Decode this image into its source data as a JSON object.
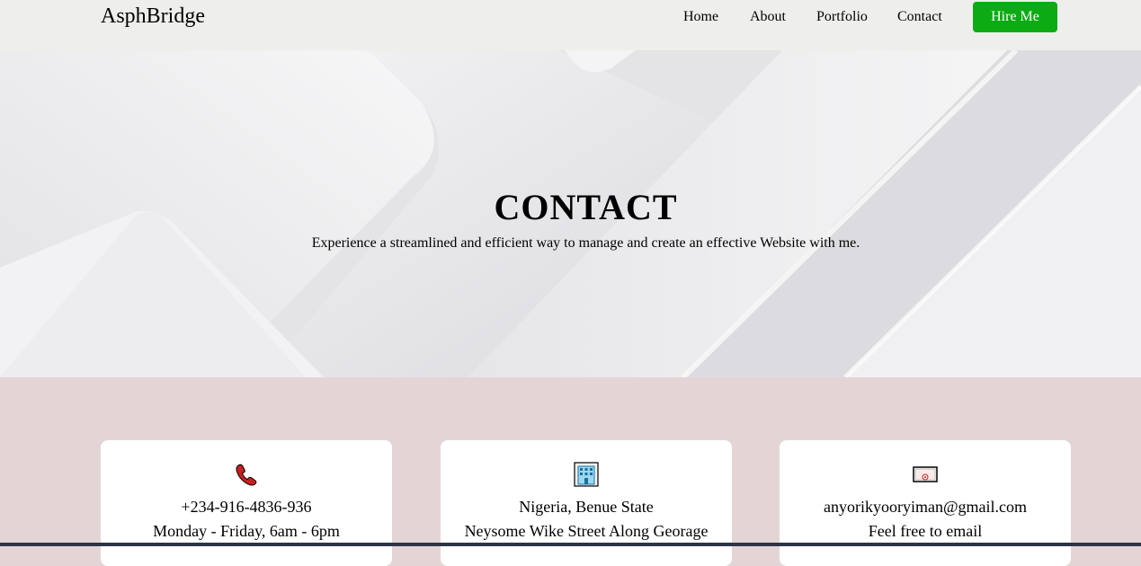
{
  "nav": {
    "brand": "AsphBridge",
    "links": [
      "Home",
      "About",
      "Portfolio",
      "Contact"
    ],
    "cta": "Hire Me",
    "cta_color": "#0cab14"
  },
  "hero": {
    "title": "CONTACT",
    "subtitle": "Experience a streamlined and efficient way to manage and create an effective Website with me."
  },
  "cards": [
    {
      "icon": "phone-icon",
      "line1": "+234-916-4836-936",
      "line2": "Monday - Friday, 6am - 6pm"
    },
    {
      "icon": "office-building-icon",
      "line1": "Nigeria, Benue State",
      "line2": "Neysome Wike Street Along Georage"
    },
    {
      "icon": "email-icon",
      "line1": "anyorikyooryiman@gmail.com",
      "line2": "Feel free to email"
    }
  ]
}
